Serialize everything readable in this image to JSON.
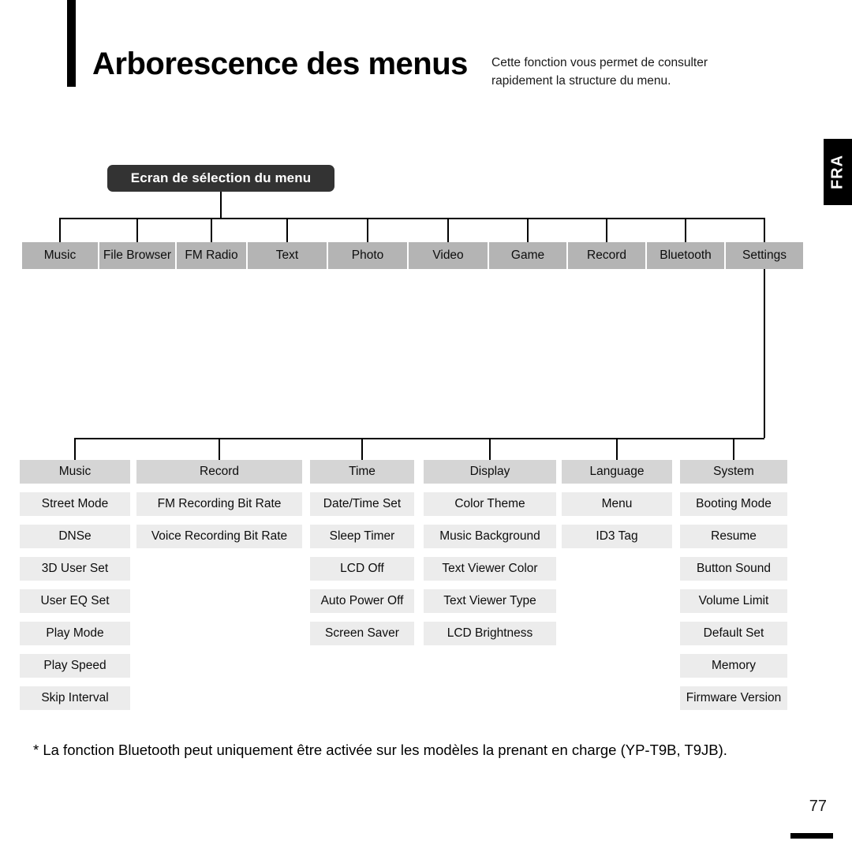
{
  "header": {
    "title": "Arborescence des menus",
    "subtitle": "Cette fonction vous permet de consulter rapidement la structure du menu.",
    "side_tab_label": "FRA",
    "accent_color": "#000000"
  },
  "diagram": {
    "root_label": "Ecran de sélection du menu",
    "root_bg": "#333333",
    "top_row_bg": "#b4b4b4",
    "header_cell_bg": "#d5d5d5",
    "item_cell_bg": "#ececec",
    "top_menu": [
      {
        "label": "Music"
      },
      {
        "label": "File Browser"
      },
      {
        "label": "FM Radio"
      },
      {
        "label": "Text"
      },
      {
        "label": "Photo"
      },
      {
        "label": "Video"
      },
      {
        "label": "Game"
      },
      {
        "label": "Record"
      },
      {
        "label": "Bluetooth"
      },
      {
        "label": "Settings"
      }
    ],
    "settings_columns": [
      {
        "header": "Music",
        "items": [
          "Street Mode",
          "DNSe",
          "3D User Set",
          "User EQ Set",
          "Play Mode",
          "Play Speed",
          "Skip Interval"
        ]
      },
      {
        "header": "Record",
        "items": [
          "FM Recording Bit Rate",
          "Voice Recording Bit Rate"
        ]
      },
      {
        "header": "Time",
        "items": [
          "Date/Time Set",
          "Sleep Timer",
          "LCD Off",
          "Auto Power Off",
          "Screen Saver"
        ]
      },
      {
        "header": "Display",
        "items": [
          "Color Theme",
          "Music Background",
          "Text Viewer Color",
          "Text Viewer Type",
          "LCD Brightness"
        ]
      },
      {
        "header": "Language",
        "items": [
          "Menu",
          "ID3 Tag"
        ]
      },
      {
        "header": "System",
        "items": [
          "Booting Mode",
          "Resume",
          "Button Sound",
          "Volume Limit",
          "Default Set",
          "Memory",
          "Firmware Version"
        ]
      }
    ]
  },
  "footnote": "* La fonction Bluetooth peut uniquement être activée sur les modèles la prenant en charge (YP-T9B, T9JB).",
  "footer": {
    "page_number": "77"
  }
}
